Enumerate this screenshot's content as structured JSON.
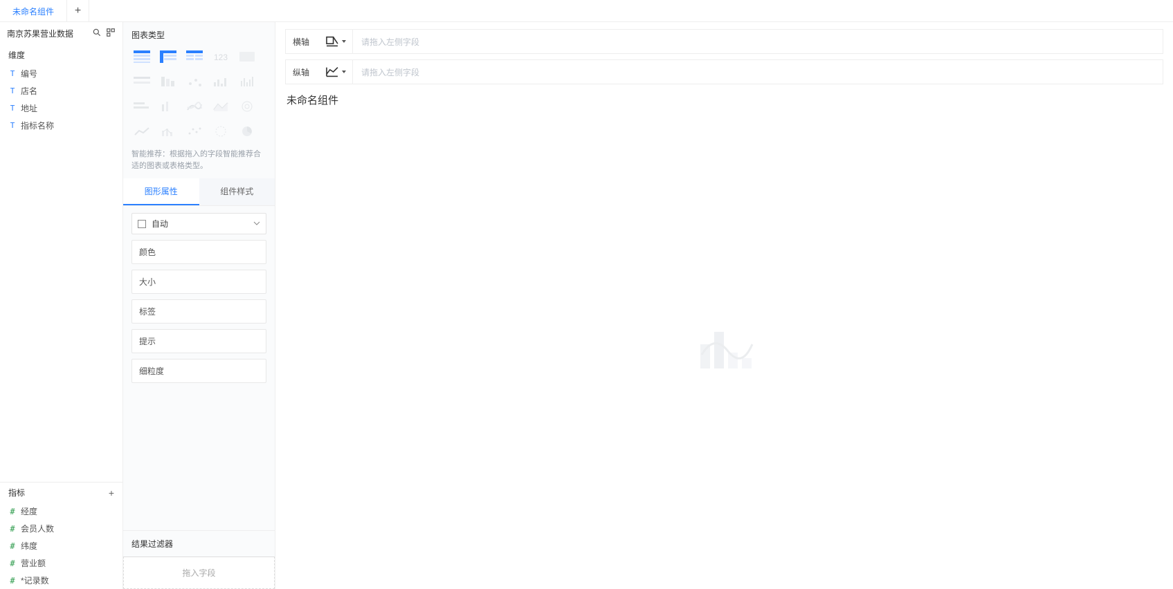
{
  "tabs": {
    "active": "未命名组件"
  },
  "data_source": {
    "title": "南京苏果营业数据"
  },
  "dimensions": {
    "header": "维度",
    "items": [
      {
        "label": "编号"
      },
      {
        "label": "店名"
      },
      {
        "label": "地址"
      },
      {
        "label": "指标名称"
      }
    ]
  },
  "measures": {
    "header": "指标",
    "items": [
      {
        "label": "经度"
      },
      {
        "label": "会员人数"
      },
      {
        "label": "纬度"
      },
      {
        "label": "营业额"
      },
      {
        "label": "*记录数"
      }
    ]
  },
  "chart_types": {
    "header": "图表类型",
    "hint": "智能推荐：根据拖入的字段智能推荐合适的图表或表格类型。",
    "names": [
      "group-table",
      "cross-table",
      "list-table",
      "kpi-card",
      "text-card",
      "partition-bar",
      "stacked-bar",
      "multi-bar",
      "bar-contrast",
      "waterfall",
      "partition-column",
      "stacked-column",
      "multi-line",
      "area",
      "radar",
      "line",
      "column-line",
      "scatter",
      "funnel",
      "pie"
    ],
    "enabled": [
      true,
      true,
      true,
      false,
      false,
      false,
      false,
      false,
      false,
      false,
      false,
      false,
      false,
      false,
      false,
      false,
      false,
      false,
      false,
      false
    ]
  },
  "prop_tabs": {
    "graphic": "图形属性",
    "component": "组件样式"
  },
  "props": {
    "auto": "自动",
    "rows": [
      {
        "label": "颜色"
      },
      {
        "label": "大小"
      },
      {
        "label": "标签"
      },
      {
        "label": "提示"
      },
      {
        "label": "细粒度"
      }
    ]
  },
  "filter": {
    "header": "结果过滤器",
    "placeholder": "拖入字段"
  },
  "axes": {
    "h_label": "横轴",
    "v_label": "纵轴",
    "placeholder": "请拖入左侧字段"
  },
  "canvas": {
    "title": "未命名组件"
  }
}
